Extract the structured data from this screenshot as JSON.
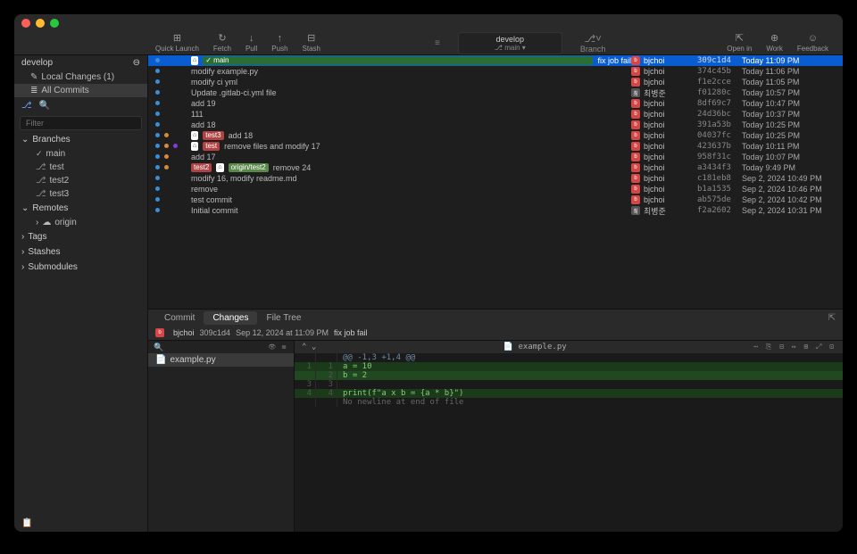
{
  "window": {
    "title": "develop",
    "subtitle": "⎇ main ▾"
  },
  "toolbar": {
    "quick_launch": "Quick Launch",
    "fetch": "Fetch",
    "pull": "Pull",
    "push": "Push",
    "stash": "Stash",
    "branch": "Branch",
    "openin": "Open in",
    "work": "Work",
    "feedback": "Feedback"
  },
  "sidebar": {
    "repo": "develop",
    "local_changes": "Local Changes (1)",
    "all_commits": "All Commits",
    "filter_ph": "Filter",
    "sections": {
      "branches": "Branches",
      "remotes": "Remotes",
      "tags": "Tags",
      "stashes": "Stashes",
      "submodules": "Submodules"
    },
    "branches": [
      "main",
      "test",
      "test2",
      "test3"
    ],
    "remotes": [
      "origin"
    ]
  },
  "commits": [
    {
      "msg": "fix job fail",
      "tags": [
        {
          "t": "head",
          "l": "⌂"
        },
        {
          "t": "main",
          "l": "✓ main"
        }
      ],
      "author": "bjchoi",
      "hash": "309c1d4",
      "date": "Today 11:09 PM",
      "sel": true,
      "g": [
        8
      ],
      "av": "b"
    },
    {
      "msg": "modify example.py",
      "author": "bjchoi",
      "hash": "374c45b",
      "date": "Today 11:06 PM",
      "g": [
        8
      ],
      "av": "b"
    },
    {
      "msg": "modify ci yml",
      "author": "bjchoi",
      "hash": "f1e2cce",
      "date": "Today 11:05 PM",
      "g": [
        8
      ],
      "av": "b"
    },
    {
      "msg": "Update .gitlab-ci.yml file",
      "author": "최병준",
      "hash": "f01280c",
      "date": "Today 10:57 PM",
      "g": [
        8
      ],
      "av": "a"
    },
    {
      "msg": "add 19",
      "author": "bjchoi",
      "hash": "8df69c7",
      "date": "Today 10:47 PM",
      "g": [
        8
      ],
      "av": "b"
    },
    {
      "msg": "111",
      "author": "bjchoi",
      "hash": "24d36bc",
      "date": "Today 10:37 PM",
      "g": [
        8
      ],
      "av": "b"
    },
    {
      "msg": "add 18",
      "author": "bjchoi",
      "hash": "391a53b",
      "date": "Today 10:25 PM",
      "g": [
        8
      ],
      "av": "b"
    },
    {
      "msg": "add 18",
      "tags": [
        {
          "t": "head",
          "l": "⌂"
        },
        {
          "t": "test",
          "l": "test3"
        }
      ],
      "author": "bjchoi",
      "hash": "04037fc",
      "date": "Today 10:25 PM",
      "g": [
        8,
        18
      ],
      "av": "b"
    },
    {
      "msg": "remove files and modify 17",
      "tags": [
        {
          "t": "head",
          "l": "⌂"
        },
        {
          "t": "test",
          "l": "test"
        }
      ],
      "author": "bjchoi",
      "hash": "423637b",
      "date": "Today 10:11 PM",
      "g": [
        8,
        18,
        28
      ],
      "av": "b"
    },
    {
      "msg": "add 17",
      "author": "bjchoi",
      "hash": "958f31c",
      "date": "Today 10:07 PM",
      "g": [
        8,
        18
      ],
      "av": "b"
    },
    {
      "msg": "remove 24",
      "tags": [
        {
          "t": "test",
          "l": "test2"
        },
        {
          "t": "head",
          "l": "⌂"
        },
        {
          "t": "origin",
          "l": "origin/test2"
        }
      ],
      "author": "bjchoi",
      "hash": "a3434f3",
      "date": "Today 9:49 PM",
      "g": [
        8,
        18
      ],
      "av": "b"
    },
    {
      "msg": "modify 16, modify readme.md",
      "author": "bjchoi",
      "hash": "c181eb8",
      "date": "Sep 2, 2024 10:49 PM",
      "g": [
        8
      ],
      "av": "b"
    },
    {
      "msg": "remove",
      "author": "bjchoi",
      "hash": "b1a1535",
      "date": "Sep 2, 2024 10:46 PM",
      "g": [
        8
      ],
      "av": "b"
    },
    {
      "msg": "test commit",
      "author": "bjchoi",
      "hash": "ab575de",
      "date": "Sep 2, 2024 10:42 PM",
      "g": [
        8
      ],
      "av": "b"
    },
    {
      "msg": "Initial commit",
      "author": "최병준",
      "hash": "f2a2602",
      "date": "Sep 2, 2024 10:31 PM",
      "g": [
        8
      ],
      "av": "a"
    }
  ],
  "detail": {
    "tabs": {
      "commit": "Commit",
      "changes": "Changes",
      "filetree": "File Tree"
    },
    "author": "bjchoi",
    "hash": "309c1d4",
    "date": "Sep 12, 2024 at 11:09 PM",
    "msg": "fix job fail",
    "file": "example.py",
    "diff": {
      "hunk": "@@ -1,3 +1,4 @@",
      "lines": [
        {
          "o": "1",
          "n": "1",
          "t": "a = 10",
          "c": "add0"
        },
        {
          "o": "",
          "n": "2",
          "t": "b = 2",
          "c": "add1"
        },
        {
          "o": "3",
          "n": "3",
          "t": "",
          "c": ""
        },
        {
          "o": "4",
          "n": "4",
          "t": "print(f\"a x b = {a * b}\")",
          "c": "add0"
        },
        {
          "o": "",
          "n": "",
          "t": "No newline at end of file",
          "c": "nofile"
        }
      ]
    }
  }
}
